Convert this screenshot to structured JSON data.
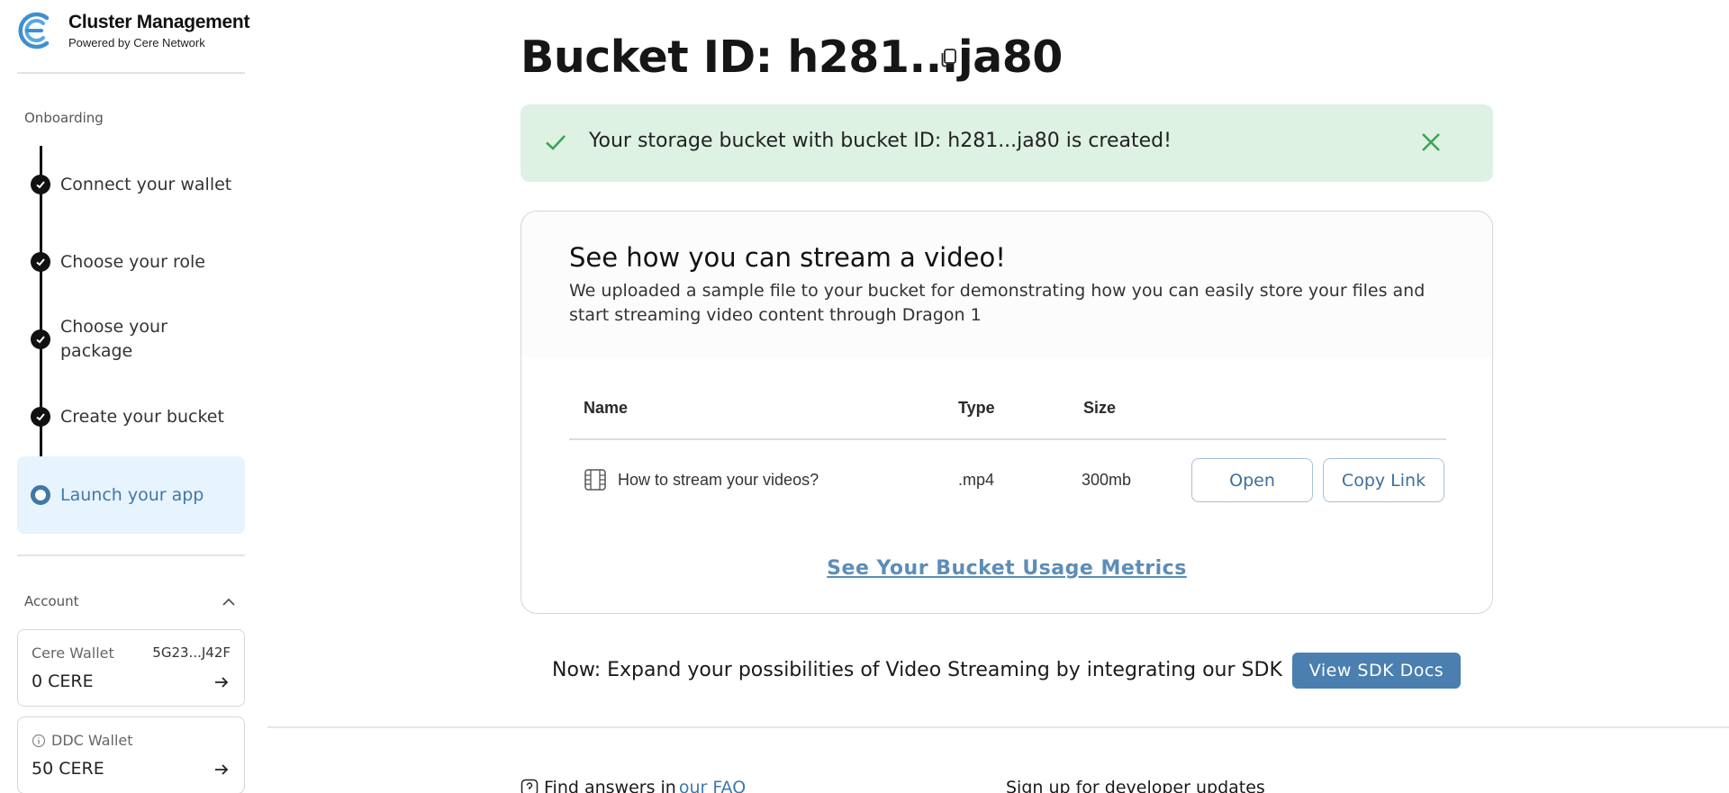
{
  "brand": {
    "title": "Cluster Management",
    "subtitle": "Powered by Cere Network"
  },
  "sidebar": {
    "onboarding_label": "Onboarding",
    "steps": [
      {
        "label": "Connect your wallet",
        "state": "done"
      },
      {
        "label": "Choose your role",
        "state": "done"
      },
      {
        "label": "Choose your package",
        "state": "done"
      },
      {
        "label": "Create your bucket",
        "state": "done"
      },
      {
        "label": "Launch your app",
        "state": "active"
      }
    ],
    "account_label": "Account",
    "wallets": [
      {
        "name": "Cere Wallet",
        "address": "5G23...J42F",
        "value": "0 CERE"
      },
      {
        "name": "DDC Wallet",
        "address": "",
        "value": "50 CERE"
      }
    ]
  },
  "main": {
    "title": "Bucket ID: h281...ja80",
    "alert": {
      "text": "Your storage bucket with bucket ID: h281...ja80 is created!"
    },
    "card": {
      "title": "See how you can stream a video!",
      "description": "We uploaded a sample file to your bucket for demonstrating how you can easily store your files and start streaming video content through Dragon 1",
      "columns": [
        "Name",
        "Type",
        "Size"
      ],
      "rows": [
        {
          "name": "How to stream your videos?",
          "type": ".mp4",
          "size": "300mb"
        }
      ],
      "open_label": "Open",
      "copy_link_label": "Copy Link",
      "metrics_link": "See Your Bucket Usage Metrics"
    },
    "cta": {
      "text": "Now: Expand your possibilities of Video Streaming by integrating our SDK",
      "button": "View SDK Docs"
    },
    "footer": {
      "faq_prefix": "Find answers in",
      "faq_link": "our FAQ",
      "signup": "Sign up for developer updates"
    }
  },
  "colors": {
    "accent": "#3f78a8",
    "success_bg": "#def2e3",
    "success_icon": "#3aa55c",
    "active_step_bg": "#e7f3fd",
    "cta_button": "#4a7fb0"
  },
  "icons": [
    "cere-logo-icon",
    "copy-icon",
    "check-icon",
    "close-icon",
    "film-icon",
    "chevron-up-icon",
    "arrow-right-icon",
    "info-icon",
    "help-icon"
  ]
}
